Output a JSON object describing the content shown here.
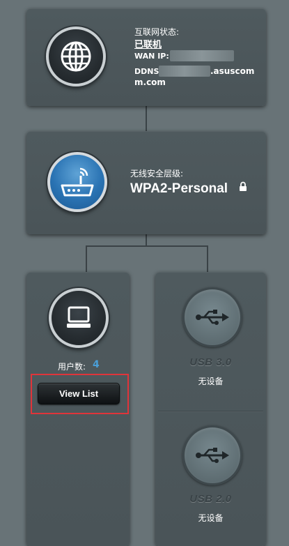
{
  "internet": {
    "status_label": "互联网状态:",
    "status_value": "已联机",
    "wan_ip_label": "WAN IP:",
    "ddns_label": "DDNS:",
    "ddns_value_line1": ".asuscom",
    "ddns_value_line2": "m.com",
    "icon": "globe-icon"
  },
  "wireless": {
    "security_label": "无线安全层级:",
    "security_value": "WPA2-Personal",
    "icon": "router-icon",
    "lock_icon": "lock-icon"
  },
  "clients": {
    "count_label": "用户数:",
    "count_value": "4",
    "view_list_label": "View List",
    "icon": "computer-icon"
  },
  "usb": [
    {
      "title": "USB 3.0",
      "status": "无设备",
      "icon": "usb-icon"
    },
    {
      "title": "USB 2.0",
      "status": "无设备",
      "icon": "usb-icon"
    }
  ],
  "colors": {
    "background": "#687377",
    "panel": "#4d575b",
    "accent_blue": "#4a9fd8",
    "highlight_red": "#e0343a"
  }
}
